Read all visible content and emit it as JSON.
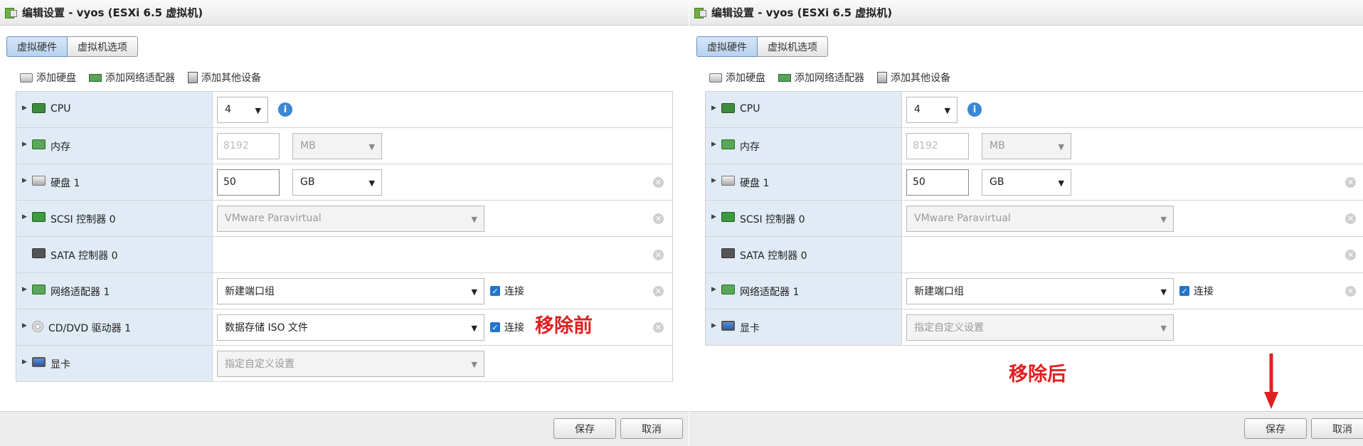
{
  "window_title": "编辑设置 - vyos (ESXi 6.5 虚拟机)",
  "tabs": [
    "虚拟硬件",
    "虚拟机选项"
  ],
  "toolbar": {
    "add_disk": "添加硬盘",
    "add_nic": "添加网络适配器",
    "add_other": "添加其他设备"
  },
  "hardware": {
    "cpu": {
      "label": "CPU",
      "value": "4"
    },
    "memory": {
      "label": "内存",
      "value_placeholder": "8192",
      "unit": "MB"
    },
    "disk": {
      "label": "硬盘 1",
      "value": "50",
      "unit": "GB"
    },
    "scsi": {
      "label": "SCSI 控制器 0",
      "value": "VMware Paravirtual"
    },
    "sata": {
      "label": "SATA 控制器 0"
    },
    "nic": {
      "label": "网络适配器 1",
      "value": "新建端口组",
      "connect": "连接"
    },
    "cd": {
      "label": "CD/DVD 驱动器 1",
      "value": "数据存储 ISO 文件",
      "connect": "连接"
    },
    "display": {
      "label": "显卡",
      "value": "指定自定义设置"
    }
  },
  "footer": {
    "save": "保存",
    "cancel": "取消"
  },
  "annotations": {
    "before": "移除前",
    "after": "移除后"
  },
  "colors": {
    "annotation": "#e02020",
    "tab_active": "#b8d2ef",
    "label_bg": "#e1ebf5",
    "checkbox": "#2275c9",
    "info": "#3a87d6"
  }
}
